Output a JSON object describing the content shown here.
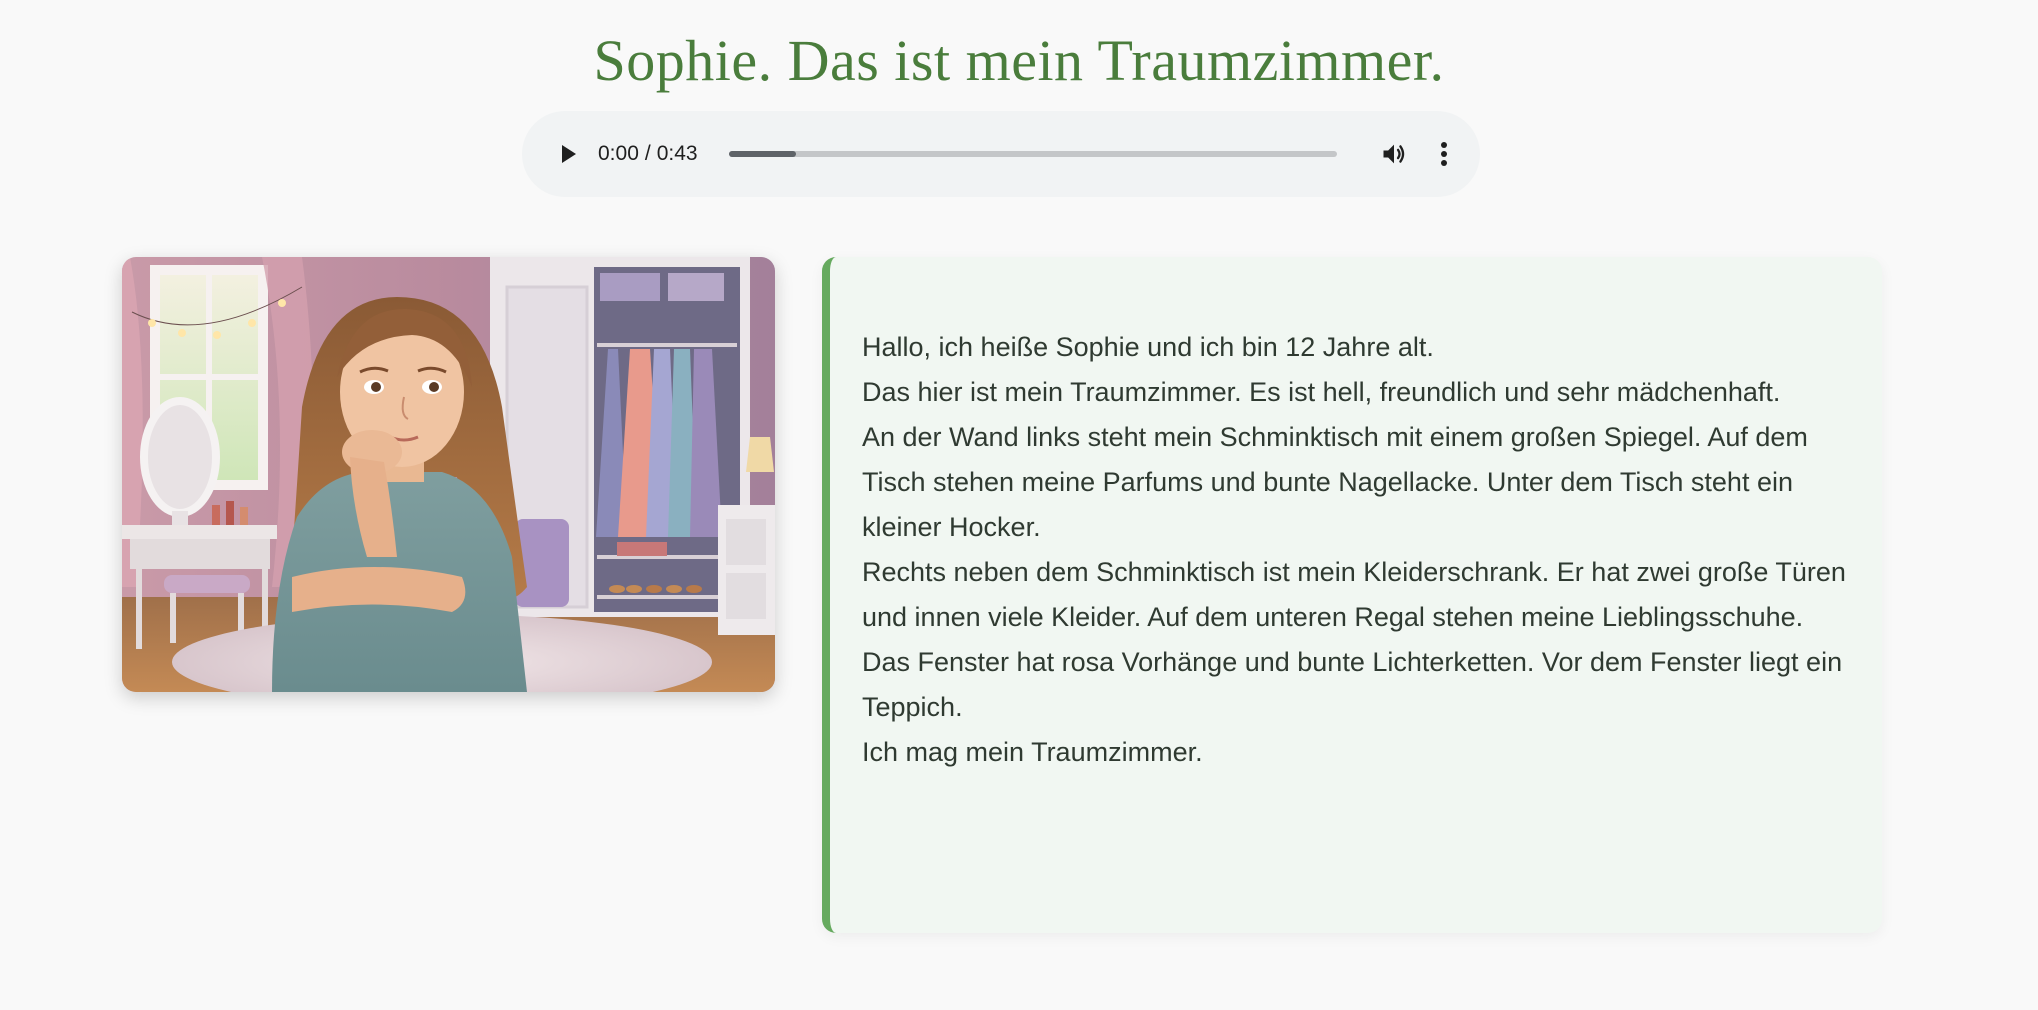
{
  "page": {
    "title": "Sophie. Das ist mein Traumzimmer."
  },
  "audio": {
    "current_time": "0:00",
    "separator": "/",
    "duration": "0:43",
    "buffered_fraction": 0.11,
    "icons": {
      "play": "play-icon",
      "volume": "volume-icon",
      "menu": "more-vertical-icon"
    }
  },
  "story": {
    "lines": [
      "Hallo, ich heiße Sophie und ich bin 12 Jahre alt.",
      "Das hier ist mein Traumzimmer. Es ist hell, freundlich und sehr mädchenhaft.",
      "An der Wand links steht mein Schminktisch mit einem großen Spiegel. Auf dem Tisch stehen meine Parfums und bunte Nagellacke. Unter dem Tisch steht ein kleiner Hocker.",
      "Rechts neben dem Schminktisch ist mein Kleiderschrank. Er hat zwei große Türen und innen viele Kleider. Auf dem unteren Regal stehen meine Lieblingsschuhe.",
      "Das Fenster hat rosa Vorhänge und bunte Lichterketten. Vor dem Fenster liegt ein Teppich.",
      "Ich mag mein Traumzimmer."
    ]
  },
  "colors": {
    "title": "#4a7d3c",
    "card_accent": "#66aa5f",
    "card_background": "#f1f7f2",
    "page_background": "#f9f9f9",
    "player_background": "#f1f3f4"
  }
}
